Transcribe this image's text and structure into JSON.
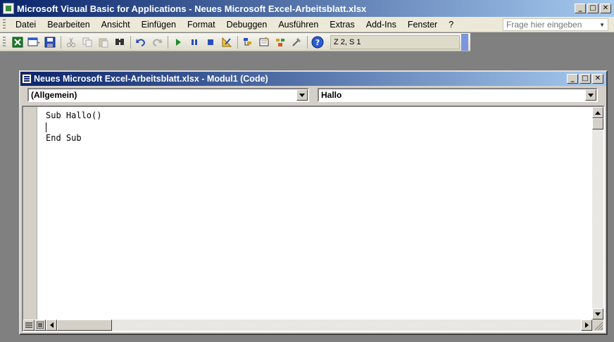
{
  "app": {
    "title": "Microsoft Visual Basic for Applications - Neues Microsoft Excel-Arbeitsblatt.xlsx"
  },
  "menu": {
    "items": [
      "Datei",
      "Bearbeiten",
      "Ansicht",
      "Einfügen",
      "Format",
      "Debuggen",
      "Ausführen",
      "Extras",
      "Add-Ins",
      "Fenster",
      "?"
    ],
    "ask_placeholder": "Frage hier eingeben"
  },
  "toolbar": {
    "position": "Z 2, S 1",
    "icons": [
      "excel-icon",
      "insert-userform-icon",
      "save-icon",
      "cut-icon",
      "copy-icon",
      "paste-icon",
      "find-icon",
      "undo-icon",
      "redo-icon",
      "run-icon",
      "break-icon",
      "reset-icon",
      "design-mode-icon",
      "project-explorer-icon",
      "properties-icon",
      "object-browser-icon",
      "toolbox-icon",
      "help-icon"
    ]
  },
  "code_window": {
    "title": "Neues Microsoft Excel-Arbeitsblatt.xlsx - Modul1 (Code)",
    "object_combo": "(Allgemein)",
    "procedure_combo": "Hallo",
    "lines": [
      "Sub Hallo()",
      "",
      "End Sub"
    ]
  },
  "colors": {
    "titlebar_start": "#0a246a",
    "titlebar_end": "#a6caf0",
    "chrome": "#d4d0c8"
  }
}
